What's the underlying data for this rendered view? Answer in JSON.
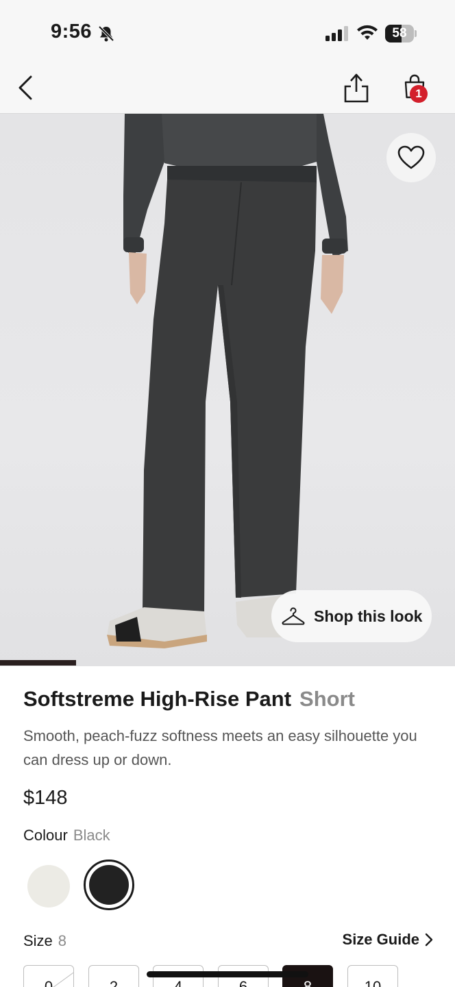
{
  "status_bar": {
    "time": "9:56",
    "battery_level": "58",
    "battery_fraction": 0.58,
    "icons": [
      "bell-slash-icon",
      "signal-icon",
      "wifi-icon",
      "battery-icon"
    ]
  },
  "nav": {
    "back_icon": "chevron-left-icon",
    "share_icon": "share-icon",
    "bag_icon": "shopping-bag-icon",
    "bag_count": "1"
  },
  "image": {
    "wishlist_icon": "heart-icon",
    "shop_look_label": "Shop this look",
    "shop_look_icon": "hanger-icon",
    "carousel_progress": 0.167
  },
  "product": {
    "name": "Softstreme High-Rise Pant",
    "variant": "Short",
    "description": "Smooth, peach-fuzz softness meets an easy silhouette you can dress up or down.",
    "price": "$148",
    "colour_label": "Colour",
    "colour_value": "Black",
    "swatches": [
      {
        "name": "cream",
        "color": "#ecebe5",
        "selected": false
      },
      {
        "name": "black",
        "color": "#222222",
        "selected": true
      }
    ],
    "size_label": "Size",
    "size_value": "8",
    "size_guide_label": "Size Guide",
    "sizes": [
      "0",
      "2",
      "4",
      "6",
      "8",
      "10"
    ]
  },
  "colors": {
    "accent_badge": "#d31f2b",
    "selected_size_bg": "#1a1212",
    "pant_color": "#3a3b3c"
  }
}
